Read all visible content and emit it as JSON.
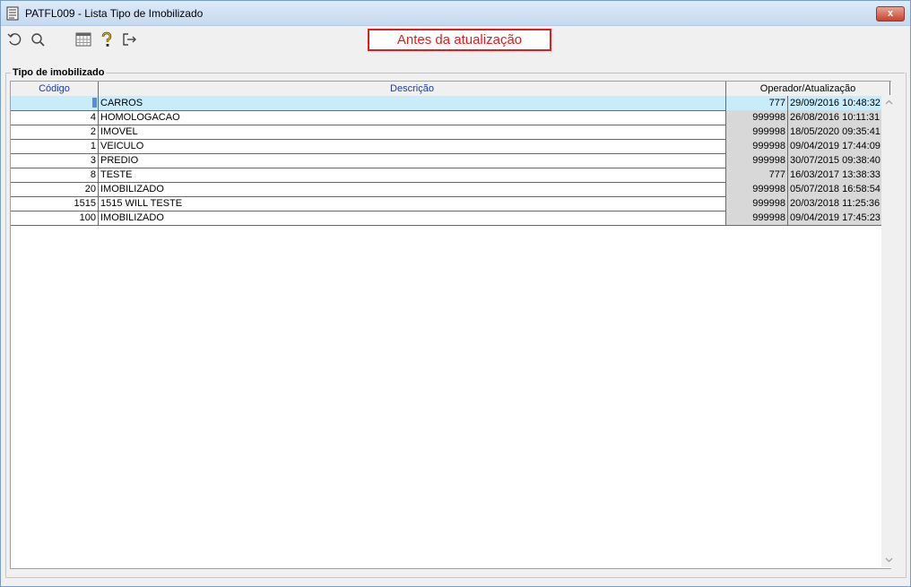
{
  "window": {
    "title": "PATFL009 - Lista Tipo de Imobilizado",
    "close_label": "x"
  },
  "toolbar": {
    "icons": [
      "undo-icon",
      "search-icon",
      "calendar-icon",
      "help-icon",
      "exit-icon"
    ],
    "banner": "Antes da atualização"
  },
  "group": {
    "title": "Tipo de imobilizado"
  },
  "table": {
    "columns": {
      "code": "Código",
      "description": "Descrição",
      "operator": "Operador/Atualização"
    },
    "rows": [
      {
        "code": "",
        "description": "CARROS",
        "operator": "777",
        "updated": "29/09/2016 10:48:32",
        "selected": true
      },
      {
        "code": "4",
        "description": "HOMOLOGACAO",
        "operator": "999998",
        "updated": "26/08/2016 10:11:31"
      },
      {
        "code": "2",
        "description": "IMOVEL",
        "operator": "999998",
        "updated": "18/05/2020 09:35:41"
      },
      {
        "code": "1",
        "description": "VEICULO",
        "operator": "999998",
        "updated": "09/04/2019 17:44:09"
      },
      {
        "code": "3",
        "description": "PREDIO",
        "operator": "999998",
        "updated": "30/07/2015 09:38:40"
      },
      {
        "code": "8",
        "description": "TESTE",
        "operator": "777",
        "updated": "16/03/2017 13:38:33"
      },
      {
        "code": "20",
        "description": "IMOBILIZADO",
        "operator": "999998",
        "updated": "05/07/2018 16:58:54"
      },
      {
        "code": "1515",
        "description": "1515 WILL TESTE",
        "operator": "999998",
        "updated": "20/03/2018 11:25:36"
      },
      {
        "code": "100",
        "description": "IMOBILIZADO",
        "operator": "999998",
        "updated": "09/04/2019 17:45:23"
      }
    ]
  },
  "colors": {
    "banner": "#e31b1b",
    "header_text": "#1e3aa8",
    "selected_row": "#c9ecfb",
    "readonly_cell": "#d8d8d8"
  }
}
